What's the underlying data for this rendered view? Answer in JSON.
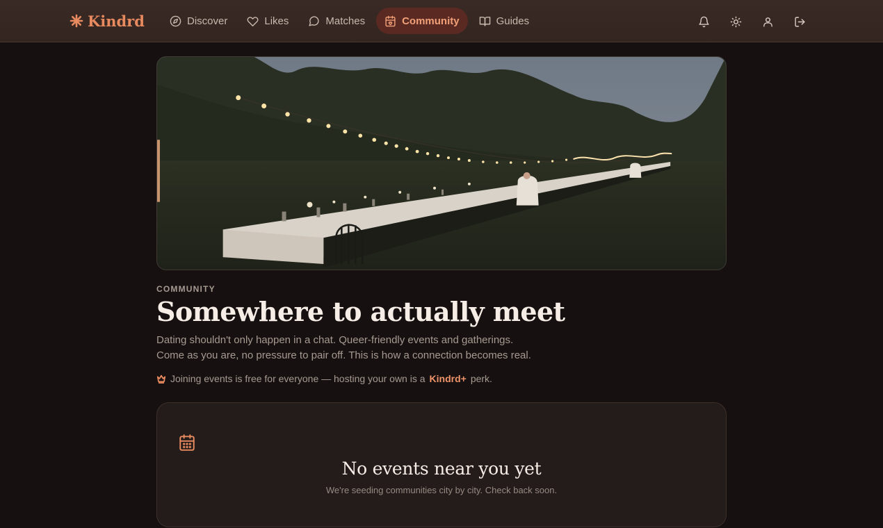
{
  "brand": {
    "name": "Kindrd"
  },
  "nav": [
    {
      "label": "Discover",
      "icon": "compass-icon",
      "active": false
    },
    {
      "label": "Likes",
      "icon": "heart-icon",
      "active": false
    },
    {
      "label": "Matches",
      "icon": "chat-bubble-icon",
      "active": false
    },
    {
      "label": "Community",
      "icon": "calendar-heart-icon",
      "active": true
    },
    {
      "label": "Guides",
      "icon": "book-open-icon",
      "active": false
    }
  ],
  "actions": [
    {
      "icon": "bell-icon"
    },
    {
      "icon": "sun-icon"
    },
    {
      "icon": "user-icon"
    },
    {
      "icon": "logout-icon"
    }
  ],
  "hero": {
    "image": "outdoor-dinner-string-lights-photo"
  },
  "page": {
    "eyebrow": "COMMUNITY",
    "title": "Somewhere to actually meet",
    "desc_line1": "Dating shouldn't only happen in a chat. Queer-friendly events and gatherings.",
    "desc_line2": "Come as you are, no pressure to pair off. This is how a connection becomes real.",
    "perk_prefix": "Joining events is free for everyone — hosting your own is a",
    "perk_brand": "Kindrd+",
    "perk_suffix": "perk."
  },
  "empty_state": {
    "icon": "calendar-icon",
    "title": "No events near you yet",
    "subtitle": "We're seeding communities city by city. Check back soon."
  },
  "colors": {
    "accent": "#e88a5f",
    "background": "#161110",
    "nav_active_bg": "#5a2a22"
  }
}
